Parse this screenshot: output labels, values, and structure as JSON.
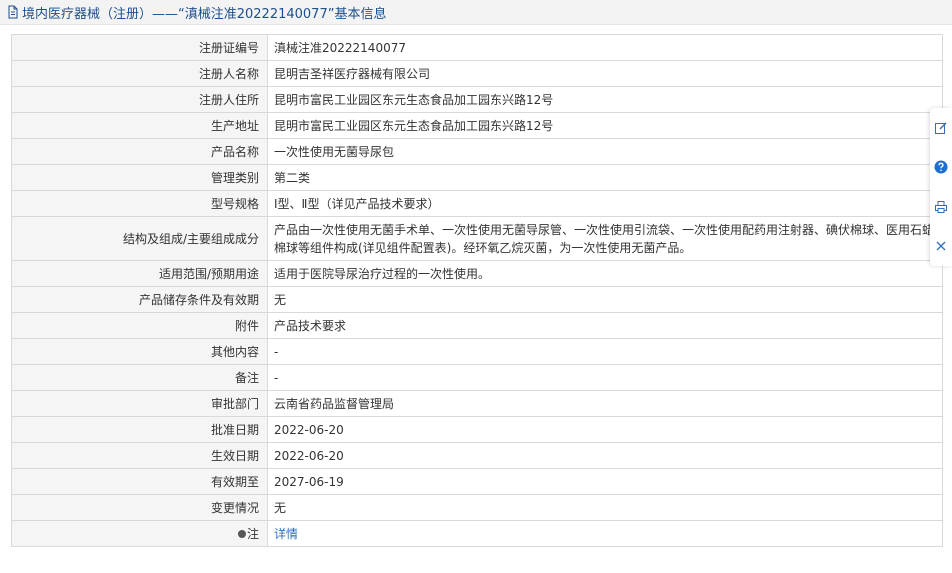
{
  "header": {
    "title": "境内医疗器械（注册）——“滇械注准20222140077”基本信息"
  },
  "rows": [
    {
      "label": "注册证编号",
      "value": "滇械注准20222140077"
    },
    {
      "label": "注册人名称",
      "value": "昆明吉圣祥医疗器械有限公司"
    },
    {
      "label": "注册人住所",
      "value": "昆明市富民工业园区东元生态食品加工园东兴路12号"
    },
    {
      "label": "生产地址",
      "value": "昆明市富民工业园区东元生态食品加工园东兴路12号"
    },
    {
      "label": "产品名称",
      "value": "一次性使用无菌导尿包"
    },
    {
      "label": "管理类别",
      "value": "第二类"
    },
    {
      "label": "型号规格",
      "value": "Ⅰ型、Ⅱ型（详见产品技术要求）"
    },
    {
      "label": "结构及组成/主要组成成分",
      "value": "产品由一次性使用无菌手术单、一次性使用无菌导尿管、一次性使用引流袋、一次性使用配药用注射器、碘伏棉球、医用石蜡棉球等组件构成(详见组件配置表)。经环氧乙烷灭菌，为一次性使用无菌产品。"
    },
    {
      "label": "适用范围/预期用途",
      "value": "适用于医院导尿治疗过程的一次性使用。"
    },
    {
      "label": "产品储存条件及有效期",
      "value": "无"
    },
    {
      "label": "附件",
      "value": "产品技术要求"
    },
    {
      "label": "其他内容",
      "value": "-"
    },
    {
      "label": "备注",
      "value": "-"
    },
    {
      "label": "审批部门",
      "value": "云南省药品监督管理局"
    },
    {
      "label": "批准日期",
      "value": "2022-06-20"
    },
    {
      "label": "生效日期",
      "value": "2022-06-20"
    },
    {
      "label": "有效期至",
      "value": "2027-06-19"
    },
    {
      "label": "变更情况",
      "value": "无"
    }
  ],
  "note": {
    "label": "注",
    "link_text": "详情"
  },
  "icons": {
    "header": "document-icon",
    "side": [
      "edit-icon",
      "help-icon",
      "print-icon",
      "close-icon"
    ],
    "note": "note-dot-icon"
  },
  "colors": {
    "header_text": "#1e4f8c",
    "link": "#2f6fbd",
    "label_bg": "#f5f5f5",
    "help": "#1e6fd0"
  }
}
